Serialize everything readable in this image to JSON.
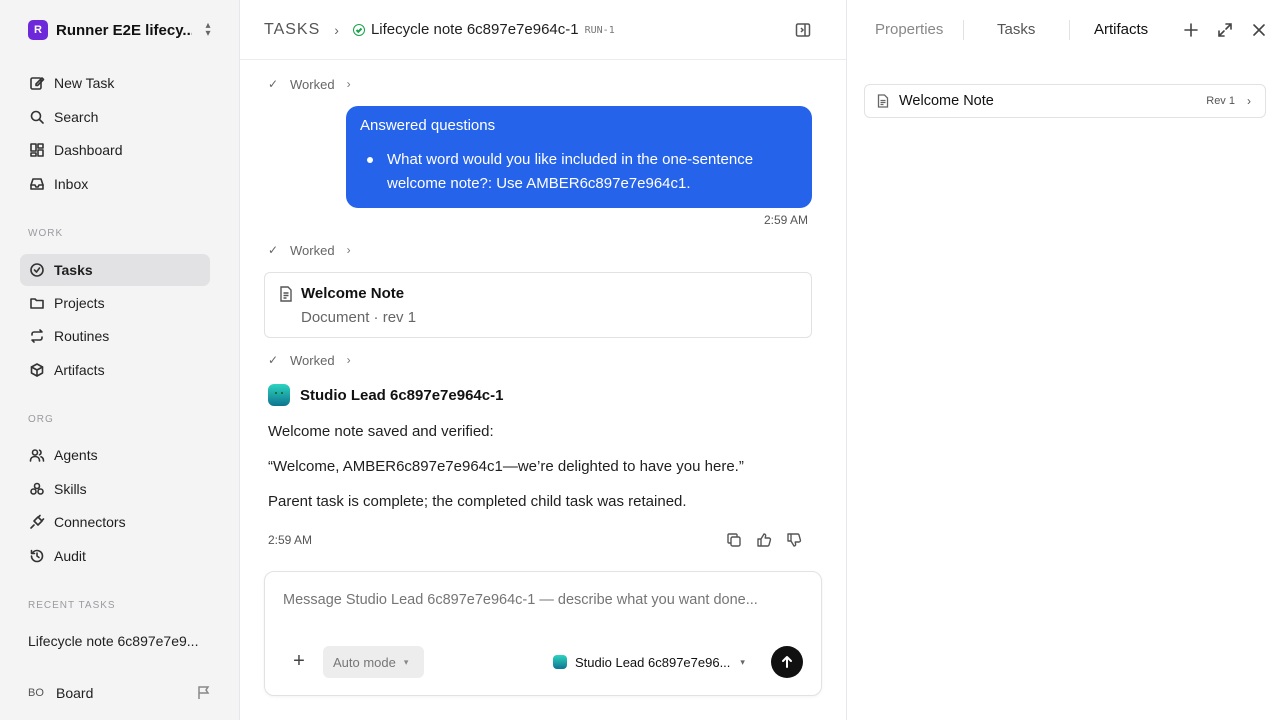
{
  "workspace": {
    "initial": "R",
    "name": "Runner E2E lifecy..."
  },
  "nav_top": [
    {
      "label": "New Task",
      "icon": "edit-icon"
    },
    {
      "label": "Search",
      "icon": "search-icon"
    },
    {
      "label": "Dashboard",
      "icon": "dashboard-icon"
    },
    {
      "label": "Inbox",
      "icon": "inbox-icon"
    }
  ],
  "sections": {
    "work": "WORK",
    "org": "ORG",
    "recent": "RECENT TASKS"
  },
  "nav_work": [
    {
      "label": "Tasks",
      "icon": "check-circle-icon",
      "active": true
    },
    {
      "label": "Projects",
      "icon": "folder-icon"
    },
    {
      "label": "Routines",
      "icon": "repeat-icon"
    },
    {
      "label": "Artifacts",
      "icon": "cube-icon"
    }
  ],
  "nav_org": [
    {
      "label": "Agents",
      "icon": "users-icon"
    },
    {
      "label": "Skills",
      "icon": "skills-icon"
    },
    {
      "label": "Connectors",
      "icon": "plug-icon"
    },
    {
      "label": "Audit",
      "icon": "history-icon"
    }
  ],
  "recent_tasks": [
    "Lifecycle note 6c897e7e9..."
  ],
  "user": {
    "initials": "BO",
    "name": "Board"
  },
  "header": {
    "root": "TASKS",
    "title": "Lifecycle note 6c897e7e964c-1",
    "run_id": "RUN-1"
  },
  "thread": {
    "worked_label": "Worked",
    "bubble": {
      "title": "Answered questions",
      "items": [
        "What word would you like included in the one-sentence welcome note?: Use AMBER6c897e7e964c1."
      ]
    },
    "time1": "2:59 AM",
    "doc": {
      "title": "Welcome Note",
      "subtitle": "Document · rev 1"
    },
    "agent": {
      "name": "Studio Lead 6c897e7e964c-1",
      "lines": [
        "Welcome note saved and verified:",
        "“Welcome, AMBER6c897e7e964c1—we’re delighted to have you here.”",
        "Parent task is complete; the completed child task was retained."
      ],
      "time": "2:59 AM"
    }
  },
  "composer": {
    "placeholder": "Message Studio Lead 6c897e7e964c-1 — describe what you want done...",
    "mode": "Auto mode",
    "agent": "Studio Lead 6c897e7e96..."
  },
  "right_panel": {
    "tabs": [
      "Properties",
      "Tasks",
      "Artifacts"
    ],
    "active_tab": "Artifacts",
    "artifacts": [
      {
        "title": "Welcome Note",
        "rev": "Rev 1"
      }
    ]
  },
  "colors": {
    "accent": "#2563eb",
    "workspace": "#6d28d9",
    "status": "#16a34a"
  }
}
